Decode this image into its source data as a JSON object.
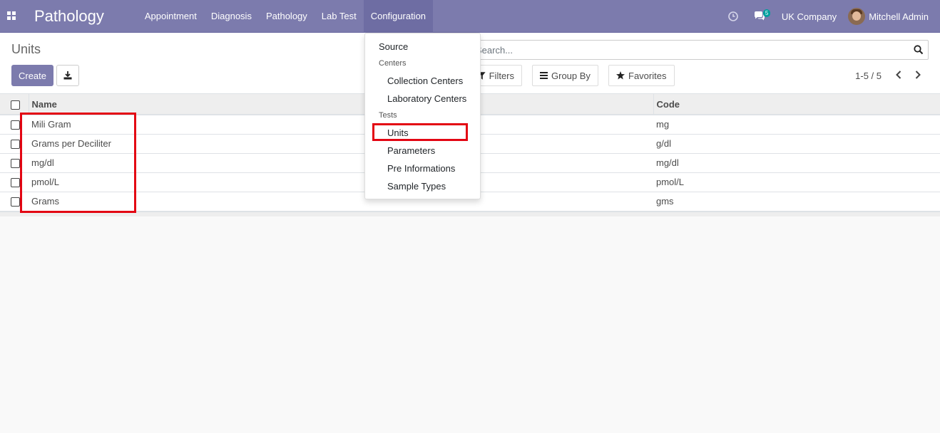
{
  "navbar": {
    "app_name": "Pathology",
    "menu": [
      "Appointment",
      "Diagnosis",
      "Pathology",
      "Lab Test",
      "Configuration"
    ],
    "message_count": "5",
    "company": "UK Company",
    "user": "Mitchell Admin"
  },
  "control_panel": {
    "breadcrumb": "Units",
    "create_label": "Create",
    "search_placeholder": "Search...",
    "filters_label": "Filters",
    "groupby_label": "Group By",
    "favorites_label": "Favorites",
    "pager": "1-5 / 5"
  },
  "table": {
    "headers": [
      "Name",
      "Code"
    ],
    "rows": [
      {
        "name": "Mili Gram",
        "code": "mg"
      },
      {
        "name": "Grams per Deciliter",
        "code": "g/dl"
      },
      {
        "name": "mg/dl",
        "code": "mg/dl"
      },
      {
        "name": "pmol/L",
        "code": "pmol/L"
      },
      {
        "name": "Grams",
        "code": "gms"
      }
    ]
  },
  "dropdown": {
    "source": "Source",
    "centers_header": "Centers",
    "collection_centers": "Collection Centers",
    "laboratory_centers": "Laboratory Centers",
    "tests_header": "Tests",
    "units": "Units",
    "parameters": "Parameters",
    "pre_informations": "Pre Informations",
    "sample_types": "Sample Types"
  },
  "colors": {
    "navbar": "#7c7bad",
    "highlight": "#e30613"
  }
}
